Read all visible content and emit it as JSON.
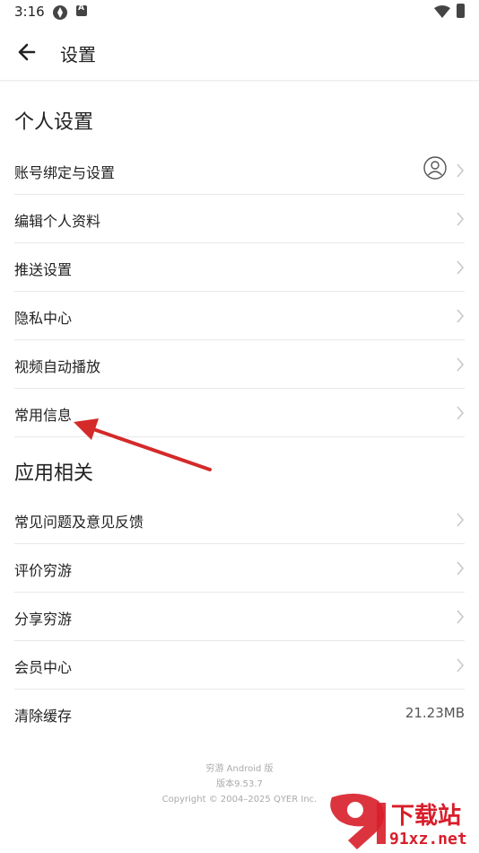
{
  "status_bar": {
    "time": "3:16"
  },
  "app_bar": {
    "title": "设置"
  },
  "sections": {
    "personal": {
      "title": "个人设置",
      "items": [
        {
          "label": "账号绑定与设置"
        },
        {
          "label": "编辑个人资料"
        },
        {
          "label": "推送设置"
        },
        {
          "label": "隐私中心"
        },
        {
          "label": "视频自动播放"
        },
        {
          "label": "常用信息"
        }
      ]
    },
    "app": {
      "title": "应用相关",
      "items": [
        {
          "label": "常见问题及意见反馈"
        },
        {
          "label": "评价穷游"
        },
        {
          "label": "分享穷游"
        },
        {
          "label": "会员中心"
        },
        {
          "label": "清除缓存",
          "value": "21.23MB"
        }
      ]
    }
  },
  "footer": {
    "line1": "穷游 Android 版",
    "line2": "版本9.53.7",
    "line3": "Copyright © 2004–2025 QYER Inc."
  },
  "watermark": {
    "text": "下载站",
    "url": "91xz.net"
  },
  "colors": {
    "annotation_arrow": "#d42a2a",
    "divider": "#e8e8e8",
    "chevron": "#c8c8c8"
  }
}
